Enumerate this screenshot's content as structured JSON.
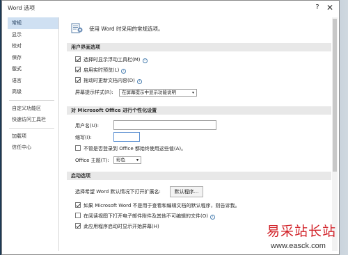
{
  "window": {
    "title": "Word 选项",
    "help_glyph": "?",
    "close_glyph": "✕"
  },
  "nav": {
    "items": [
      {
        "label": "常规",
        "active": true
      },
      {
        "label": "显示"
      },
      {
        "label": "校对"
      },
      {
        "label": "保存"
      },
      {
        "label": "版式"
      },
      {
        "label": "语言"
      },
      {
        "label": "高级"
      },
      {
        "label": "自定义功能区"
      },
      {
        "label": "快速访问工具栏"
      },
      {
        "label": "加载项"
      },
      {
        "label": "信任中心"
      }
    ]
  },
  "hero": {
    "text": "使用 Word 时采用的常规选项。",
    "icon": "options-settings-icon"
  },
  "sections": {
    "ui_options": {
      "title": "用户界面选项",
      "show_mini_toolbar": {
        "label": "选择时显示浮动工具栏(M)",
        "checked": true
      },
      "live_preview": {
        "label": "启用实时预览(L)",
        "checked": true
      },
      "update_while_dragging": {
        "label": "拖动时更新文档内容(D)",
        "checked": true
      },
      "screentip_label": "屏幕提示样式(R):",
      "screentip_value": "在屏幕提示中显示功能说明"
    },
    "personalize": {
      "title": "对 Microsoft Office 进行个性化设置",
      "username_label": "用户名(U):",
      "username_value": "",
      "initials_label": "缩写(I):",
      "initials_value": "",
      "always_use": {
        "label": "不管是否登录到 Office 都始终使用这些值(A)。",
        "checked": false
      },
      "theme_label": "Office 主题(T):",
      "theme_value": "彩色"
    },
    "startup": {
      "title": "启动选项",
      "extensions_label": "选择希望 Word 默认情况下打开扩展名:",
      "default_programs_button": "默认程序...",
      "tell_me": {
        "label": "如果 Microsoft Word 不是用于查看和编辑文档的默认程序，则告诉我。",
        "checked": true
      },
      "open_attachments": {
        "label": "在阅读视图下打开电子邮件附件及其他不可编辑的文件(O)",
        "checked": false
      },
      "show_start_screen": {
        "label": "此应用程序启动时显示开始屏幕(H)",
        "checked": true
      }
    }
  },
  "watermark": {
    "main": "易采站长站",
    "url": "www.easck.com"
  },
  "colors": {
    "nav_active": "#cfe0f2",
    "section_header": "#e8e8e8",
    "watermark_red": "#d2232a"
  }
}
